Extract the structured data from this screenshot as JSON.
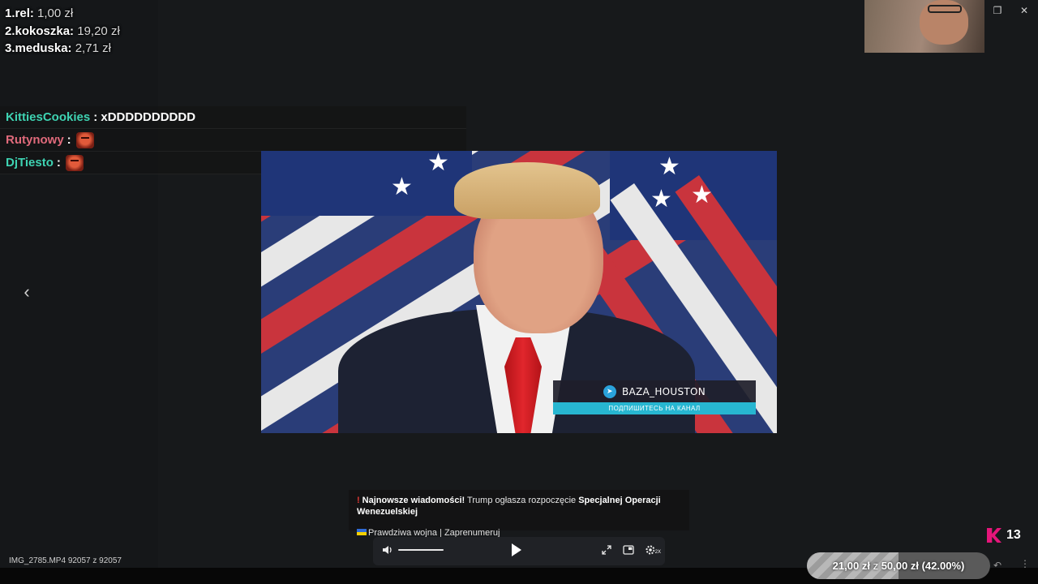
{
  "ranking": [
    {
      "place": "1.",
      "name": "rel:",
      "amount": "1,00 zł"
    },
    {
      "place": "2.",
      "name": "kokoszka:",
      "amount": "19,20 zł"
    },
    {
      "place": "3.",
      "name": "meduska:",
      "amount": "2,71 zł"
    }
  ],
  "chat": [
    {
      "user": "KittiesCookies",
      "color": "#3ed3b2",
      "message": ": xDDDDDDDDDD"
    },
    {
      "user": "Rutynowy",
      "color": "#e06a7b",
      "message": ":"
    },
    {
      "user": "DjTiesto",
      "color": "#3ed3b2",
      "message": ":"
    }
  ],
  "video": {
    "channel": "BAZA_HOUSTON",
    "subscribe": "ПОДПИШИТЕСЬ НА КАНАЛ"
  },
  "caption": {
    "line1_bold1": "Najnowsze wiadomości!",
    "line1_text": " Trump ogłasza rozpoczęcie ",
    "line1_bold2": "Specjalnej Operacji Wenezuelskiej",
    "line2": "Prawdziwa wojna | Zaprenumeruj"
  },
  "player": {
    "volume": 1.0,
    "speed_badge": "2X"
  },
  "file": {
    "label": "IMG_2785.MP4 92057 z 92057"
  },
  "counter": {
    "value": "13"
  },
  "goal": {
    "current": "21,00 zł",
    "of": "z",
    "target": "50,00 zł",
    "percent_text": "(42.00%)",
    "fraction": 0.42
  },
  "icons": {
    "prev": "chevron-left-icon",
    "volume": "volume-icon",
    "fullscreen": "fullscreen-icon",
    "pip": "picture-in-picture-icon",
    "settings": "settings-icon"
  }
}
